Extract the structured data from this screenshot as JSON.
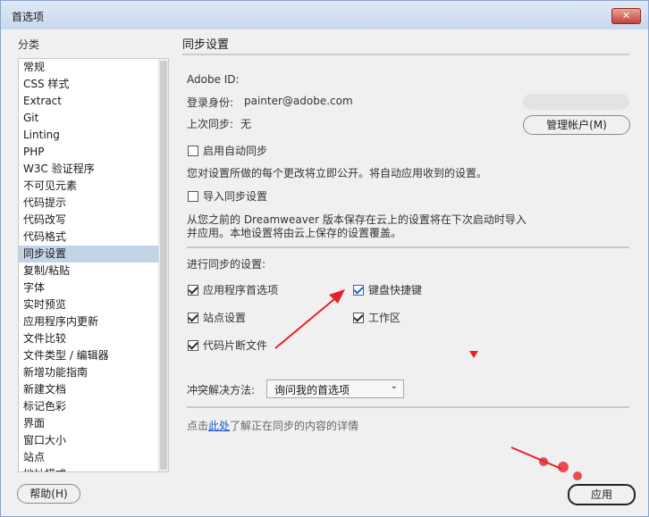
{
  "window": {
    "title": "首选项",
    "close_icon": "✕"
  },
  "categories": {
    "label": "分类",
    "items": [
      "常规",
      "CSS 样式",
      "Extract",
      "Git",
      "Linting",
      "PHP",
      "W3C 验证程序",
      "不可见元素",
      "代码提示",
      "代码改写",
      "代码格式",
      "同步设置",
      "复制/粘贴",
      "字体",
      "实时预览",
      "应用程序内更新",
      "文件比较",
      "文件类型 / 编辑器",
      "新增功能指南",
      "新建文档",
      "标记色彩",
      "界面",
      "窗口大小",
      "站点",
      "地址模式"
    ],
    "selected_index": 11
  },
  "sync": {
    "section_title": "同步设置",
    "adobe_id_label": "Adobe ID:",
    "login_label": "登录身份: ",
    "login_value": "painter@adobe.com",
    "last_sync_label": "上次同步:",
    "last_sync_value": "无",
    "manage_account_button": "管理帐户(M)",
    "auto_sync_label": "启用自动同步",
    "auto_sync_desc": "您对设置所做的每个更改将立即公开。将自动应用收到的设置。",
    "import_sync_label": "导入同步设置",
    "import_desc_line1": "从您之前的 Dreamweaver 版本保存在云上的设置将在下次启动时导入",
    "import_desc_line2": "并应用。本地设置将由云上保存的设置覆盖。",
    "sync_settings_label": "进行同步的设置:",
    "options": {
      "app_prefs": "应用程序首选项",
      "keyboard_shortcuts": "键盘快捷键",
      "site_settings": "站点设置",
      "workspace": "工作区",
      "code_snippets": "代码片断文件"
    },
    "conflict_label": "冲突解决方法:",
    "conflict_value": "询问我的首选项",
    "details_prefix": "点击",
    "details_link": "此处",
    "details_suffix": "了解正在同步的内容的详情"
  },
  "footer": {
    "help_button": "帮助(H)",
    "apply_button": "应用"
  },
  "colors": {
    "selected_row": "#c3d4e8",
    "arrow_red": "#e8202a",
    "link": "#1a56c8"
  }
}
